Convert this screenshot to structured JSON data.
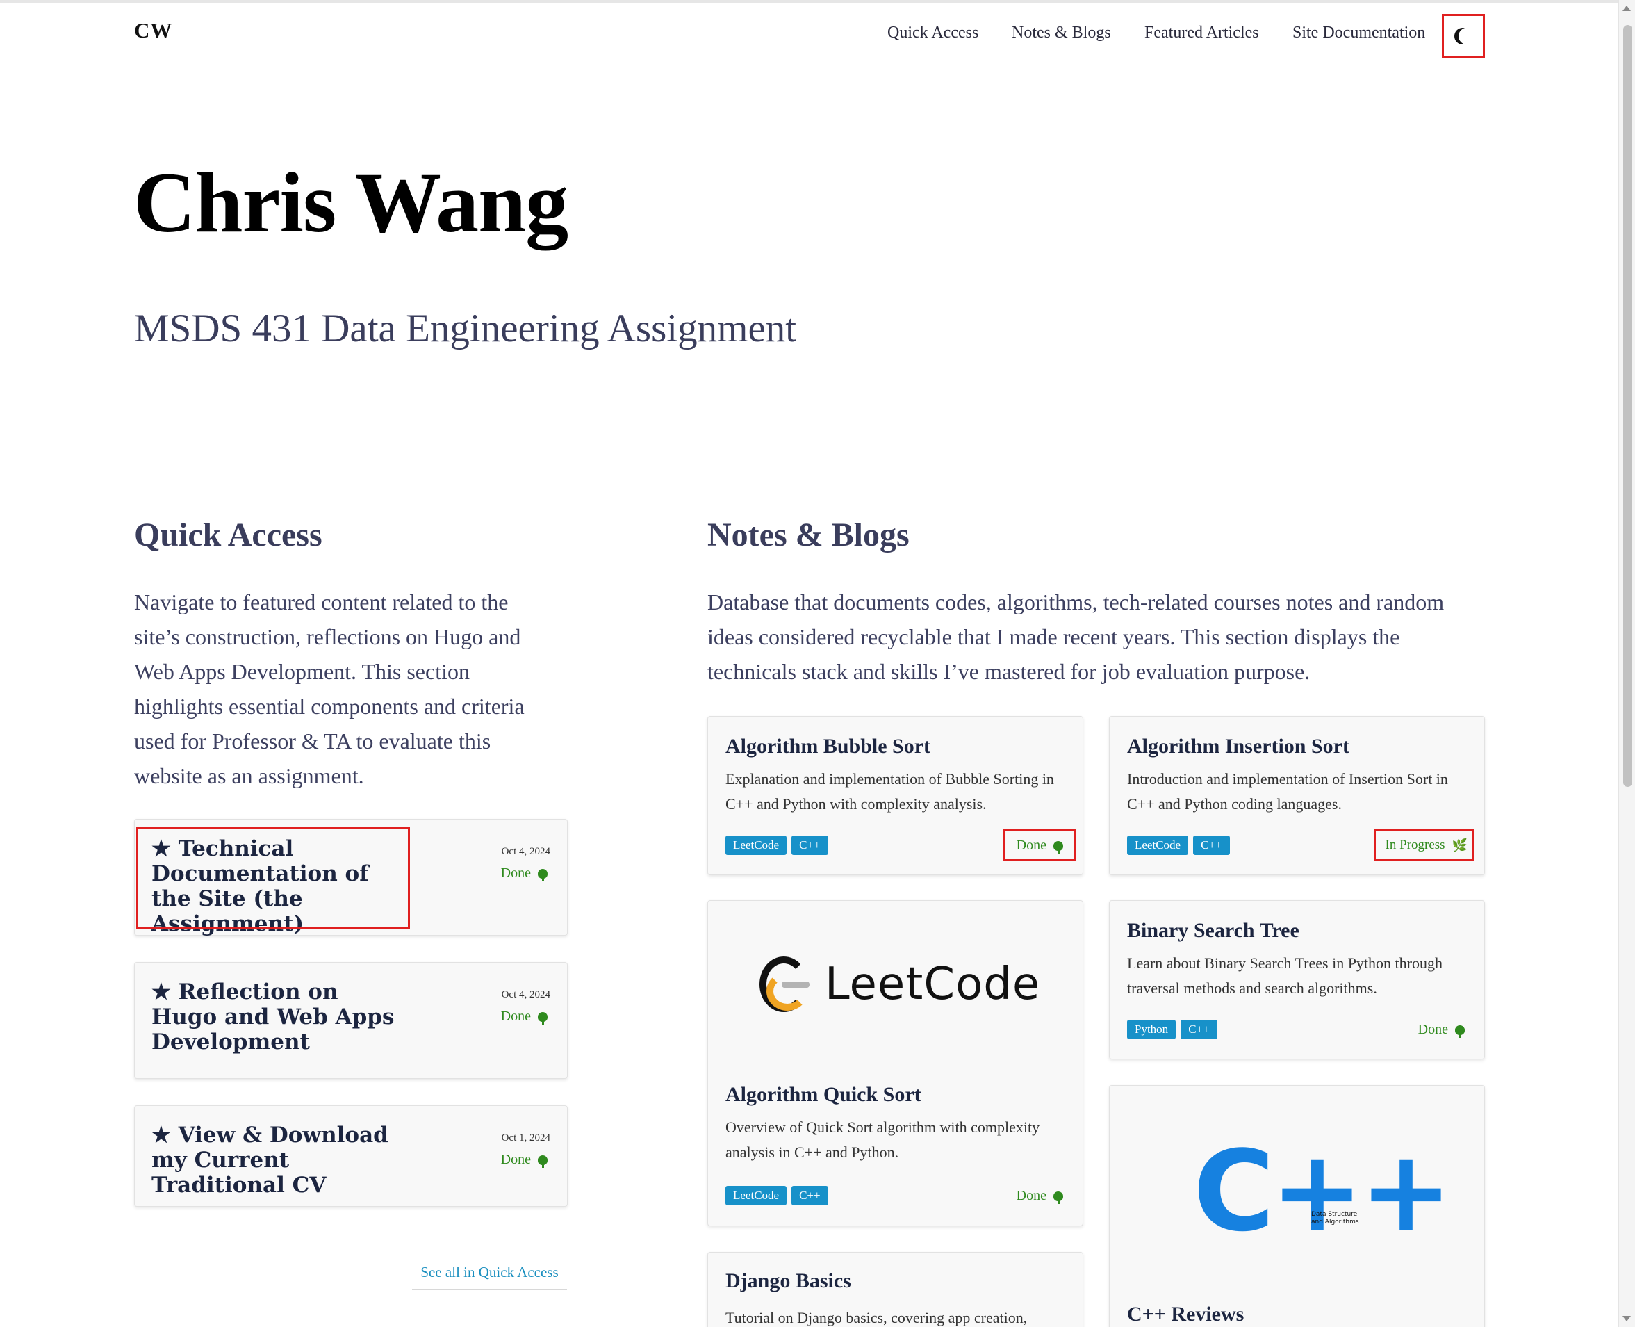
{
  "site": {
    "logo": "CW"
  },
  "nav": {
    "items": [
      "Quick Access",
      "Notes & Blogs",
      "Featured Articles",
      "Site Documentation"
    ],
    "theme_toggle_icon": "moon-icon"
  },
  "hero": {
    "title": "Chris Wang",
    "subtitle": "MSDS 431 Data Engineering Assignment"
  },
  "quick_access": {
    "heading": "Quick Access",
    "description": "Navigate to featured content related to the site’s construction, reflections on Hugo and Web Apps Development. This section highlights essential components and criteria used for Professor & TA to evaluate this website as an assignment.",
    "cards": [
      {
        "title": "★ Technical Documentation of the Site (the Assignment)",
        "date": "Oct 4, 2024",
        "status": "Done"
      },
      {
        "title": "★ Reflection on Hugo and Web Apps Development",
        "date": "Oct 4, 2024",
        "status": "Done"
      },
      {
        "title": "★ View & Download my Current Traditional CV",
        "date": "Oct 1, 2024",
        "status": "Done"
      }
    ],
    "see_all": "See all in Quick Access"
  },
  "notes_blogs": {
    "heading": "Notes & Blogs",
    "description": "Database that documents codes, algorithms, tech-related courses notes and random ideas considered recyclable that I made recent years. This section displays the technicals stack and skills I’ve mastered for job evaluation purpose.",
    "cards": [
      {
        "title": "Algorithm Bubble Sort",
        "desc": "Explanation and implementation of Bubble Sorting in C++ and Python with complexity analysis.",
        "tags": [
          "LeetCode",
          "C++"
        ],
        "status": "Done"
      },
      {
        "title": "Algorithm Insertion Sort",
        "desc": "Introduction and implementation of Insertion Sort in C++ and Python coding languages.",
        "tags": [
          "LeetCode",
          "C++"
        ],
        "status": "In Progress"
      },
      {
        "title": "Algorithm Quick Sort",
        "desc": "Overview of Quick Sort algorithm with complexity analysis in C++ and Python.",
        "tags": [
          "LeetCode",
          "C++"
        ],
        "status": "Done",
        "image": "LeetCode"
      },
      {
        "title": "Binary Search Tree",
        "desc": "Learn about Binary Search Trees in Python through traversal methods and search algorithms.",
        "tags": [
          "Python",
          "C++"
        ],
        "status": "Done"
      },
      {
        "title": "Django Basics",
        "desc": "Tutorial on Django basics, covering app creation,"
      },
      {
        "title": "C++ Reviews",
        "image": "C++",
        "image_caption": [
          "Data Structure",
          "and Algorithms"
        ]
      }
    ]
  },
  "colors": {
    "accent_tag": "#1791c9",
    "status_done": "#2f8a1e",
    "highlight": "#e02020",
    "link": "#1a8fbf"
  }
}
